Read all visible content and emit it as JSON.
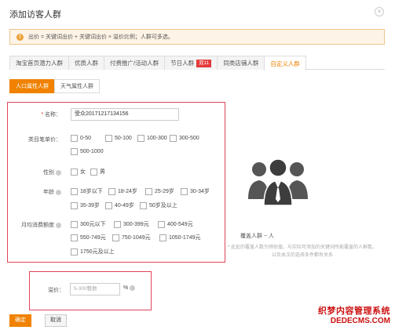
{
  "dialog": {
    "title": "添加访客人群",
    "close_glyph": "×"
  },
  "notice": {
    "icon": "!",
    "text": "出价 = 关键词出价 + 关键词出价 × 溢价比例；人群可多选。"
  },
  "tabs": [
    {
      "label": "淘宝首页潜力人群",
      "active": false
    },
    {
      "label": "优质人群",
      "active": false
    },
    {
      "label": "付费推广/活动人群",
      "active": false
    },
    {
      "label": "节日人群",
      "badge": "双11",
      "active": false
    },
    {
      "label": "同类店铺人群",
      "active": false
    },
    {
      "label": "自定义人群",
      "active": true
    }
  ],
  "subtabs": [
    {
      "label": "人口属性人群",
      "active": true
    },
    {
      "label": "天气属性人群",
      "active": false
    }
  ],
  "form": {
    "name_label": "名称：",
    "name_value": "受众20171217134156",
    "price_label": "类目笔单价：",
    "price_options": [
      "0-50",
      "50-100",
      "100-300",
      "300-500",
      "500-1000"
    ],
    "gender_label": "性别",
    "gender_options": [
      "女",
      "男"
    ],
    "age_label": "年龄",
    "age_options": [
      "18岁以下",
      "18-24岁",
      "25-29岁",
      "30-34岁",
      "35-39岁",
      "40-49岁",
      "50岁及以上"
    ],
    "spend_label": "月均消费额度",
    "spend_options": [
      "300元以下",
      "300-399元",
      "400-549元",
      "550-749元",
      "750-1049元",
      "1050-1749元",
      "1750元及以上"
    ]
  },
  "bid": {
    "label": "溢价：",
    "placeholder": "5-300整数",
    "unit": "%"
  },
  "buttons": {
    "ok": "确定",
    "cancel": "取消"
  },
  "preview": {
    "cover_label": "覆盖人群 ~ 人",
    "note": "* 此处的覆盖人数为预估值，与实际可添加的关键词所能覆盖的人群数，以及本次的选择条件都有关系"
  },
  "watermark": {
    "line1": "织梦内容管理系统",
    "line2": "DEDECMS.COM"
  }
}
